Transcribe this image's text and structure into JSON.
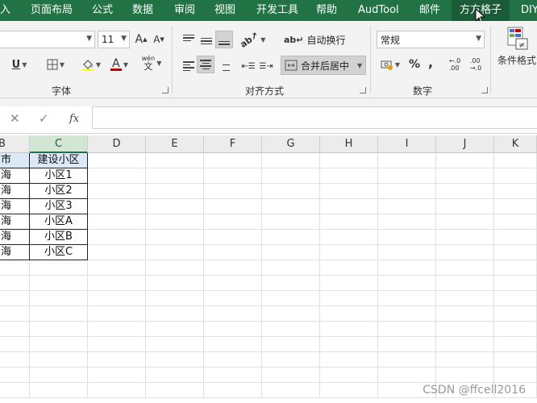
{
  "ribbon_tabs": [
    "入",
    "页面布局",
    "公式",
    "数据",
    "审阅",
    "视图",
    "开发工具",
    "帮助",
    "AudTool",
    "邮件",
    "方方格子",
    "DIY"
  ],
  "active_tab_index": 10,
  "font_group": {
    "size_value": "11",
    "grow_label": "A",
    "shrink_label": "A",
    "underline_label": "U",
    "font_color_label": "A",
    "phonetic_top": "wén",
    "phonetic_bottom": "文",
    "group_label": "字体",
    "accent_underline": "#c00000"
  },
  "align_group": {
    "wrap_text_label": "自动换行",
    "merge_center_label": "合并后居中",
    "group_label": "对齐方式"
  },
  "number_group": {
    "format_value": "常规",
    "percent_label": "%",
    "comma_label": ",",
    "inc_decimal_top": "←.0",
    "inc_decimal_bottom": ".00",
    "dec_decimal_top": ".00",
    "dec_decimal_bottom": "→.0",
    "group_label": "数字"
  },
  "styles_group": {
    "conditional_format_label": "条件格式"
  },
  "formula_bar": {
    "cancel_symbol": "✕",
    "enter_symbol": "✓",
    "fx_symbol": "fx",
    "value": ""
  },
  "columns": [
    "B",
    "C",
    "D",
    "E",
    "F",
    "G",
    "H",
    "I",
    "J",
    "K"
  ],
  "table": {
    "header": [
      "市",
      "建设小区"
    ],
    "rows": [
      [
        "海",
        "小区1"
      ],
      [
        "海",
        "小区2"
      ],
      [
        "海",
        "小区3"
      ],
      [
        "海",
        "小区A"
      ],
      [
        "海",
        "小区B"
      ],
      [
        "海",
        "小区C"
      ]
    ],
    "header_fill": "#dbe8f5"
  },
  "theme": {
    "ribbon_green": "#217346"
  },
  "watermark": "CSDN @ffcell2016"
}
